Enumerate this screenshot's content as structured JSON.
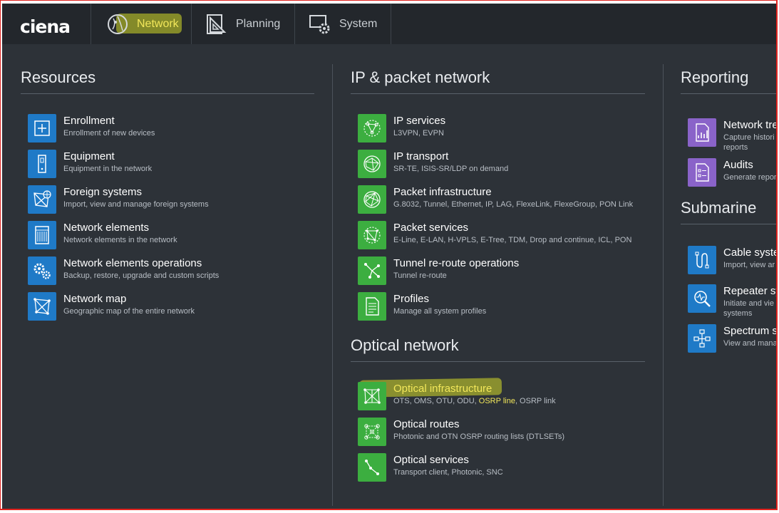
{
  "brand": {
    "logo_text": "ciena"
  },
  "tabs": [
    {
      "label": "Network",
      "icon": "globe-icon",
      "active": true
    },
    {
      "label": "Planning",
      "icon": "drafting-triangle-icon",
      "active": false
    },
    {
      "label": "System",
      "icon": "monitor-gear-icon",
      "active": false
    }
  ],
  "columns": {
    "resources": {
      "title": "Resources",
      "items": [
        {
          "title": "Enrollment",
          "subtitle": "Enrollment of new devices",
          "icon": "plus-box-icon"
        },
        {
          "title": "Equipment",
          "subtitle": "Equipment in the network",
          "icon": "card-icon"
        },
        {
          "title": "Foreign systems",
          "subtitle": "Import, view and manage foreign systems",
          "icon": "foreign-network-icon"
        },
        {
          "title": "Network elements",
          "subtitle": "Network elements in the network",
          "icon": "shelf-icon"
        },
        {
          "title": "Network elements operations",
          "subtitle": "Backup, restore, upgrade and custom scripts",
          "icon": "gears-icon"
        },
        {
          "title": "Network map",
          "subtitle": "Geographic map of the entire network",
          "icon": "network-map-icon"
        }
      ]
    },
    "ip_packet": {
      "title": "IP & packet network",
      "items": [
        {
          "title": "IP services",
          "subtitle": "L3VPN, EVPN",
          "icon": "ip-services-icon"
        },
        {
          "title": "IP transport",
          "subtitle": "SR-TE, ISIS-SR/LDP on demand",
          "icon": "ip-transport-icon"
        },
        {
          "title": "Packet infrastructure",
          "subtitle": "G.8032, Tunnel, Ethernet, IP, LAG, FlexeLink, FlexeGroup, PON Link",
          "icon": "packet-infrastructure-icon"
        },
        {
          "title": "Packet services",
          "subtitle": "E-Line, E-LAN, H-VPLS, E-Tree, TDM, Drop and continue, ICL, PON",
          "icon": "packet-services-icon"
        },
        {
          "title": "Tunnel re-route operations",
          "subtitle": "Tunnel re-route",
          "icon": "reroute-icon"
        },
        {
          "title": "Profiles",
          "subtitle": "Manage all system profiles",
          "icon": "document-icon"
        }
      ]
    },
    "optical": {
      "title": "Optical network",
      "items": [
        {
          "title": "Optical infrastructure",
          "subtitle_before": "OTS, OMS, OTU, ODU, ",
          "subtitle_highlight": "OSRP line",
          "subtitle_after": ", OSRP link",
          "icon": "optical-infrastructure-icon"
        },
        {
          "title": "Optical routes",
          "subtitle": "Photonic and OTN OSRP routing lists (DTLSETs)",
          "icon": "optical-routes-icon"
        },
        {
          "title": "Optical services",
          "subtitle": "Transport client, Photonic, SNC",
          "icon": "optical-services-icon"
        }
      ]
    },
    "reporting": {
      "title": "Reporting",
      "items": [
        {
          "title": "Network tre",
          "subtitle": "Capture histori reports",
          "icon": "report-chart-icon"
        },
        {
          "title": "Audits",
          "subtitle": "Generate repor",
          "icon": "audit-list-icon"
        }
      ]
    },
    "submarine": {
      "title": "Submarine",
      "items": [
        {
          "title": "Cable syste",
          "subtitle": "Import, view ar",
          "icon": "cable-icon"
        },
        {
          "title": "Repeater sy",
          "subtitle": "Initiate and vie systems",
          "icon": "repeater-search-icon"
        },
        {
          "title": "Spectrum s",
          "subtitle": "View and mana",
          "icon": "spectrum-icon"
        }
      ]
    }
  },
  "colors": {
    "background": "#2d3238",
    "topbar": "#23272c",
    "accent_blue": "#1f7ac7",
    "accent_green": "#3cae40",
    "accent_purple": "#8a63c9",
    "highlight_yellow": "#f2e75a"
  }
}
